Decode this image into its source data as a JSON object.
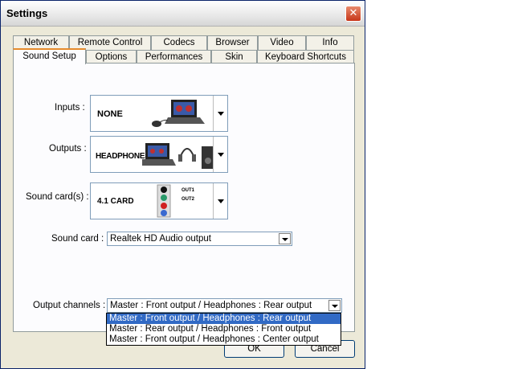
{
  "window": {
    "title": "Settings",
    "close_glyph": "✕"
  },
  "tabs_row1": [
    {
      "label": "Network"
    },
    {
      "label": "Remote Control"
    },
    {
      "label": "Codecs"
    },
    {
      "label": "Browser"
    },
    {
      "label": "Video"
    },
    {
      "label": "Info"
    }
  ],
  "tabs_row2": [
    {
      "label": "Sound Setup",
      "active": true
    },
    {
      "label": "Options"
    },
    {
      "label": "Performances"
    },
    {
      "label": "Skin"
    },
    {
      "label": "Keyboard Shortcuts"
    }
  ],
  "sound": {
    "inputs_label": "Inputs :",
    "inputs_value": "NONE",
    "outputs_label": "Outputs :",
    "outputs_value": "HEADPHONES",
    "cards_label": "Sound card(s) :",
    "cards_value": "4.1 CARD",
    "out1": "OUT1",
    "out2": "OUT2",
    "soundcard_label": "Sound card :",
    "soundcard_value": "Realtek HD Audio output",
    "channels_label": "Output channels :",
    "channels_value": "Master : Front output / Headphones : Rear output",
    "channels_options": [
      "Master : Front output / Headphones : Rear output",
      "Master : Rear output / Headphones : Front output",
      "Master : Front output / Headphones : Center output"
    ]
  },
  "buttons": {
    "ok": "OK",
    "cancel": "Cancel"
  },
  "colors": {
    "accent_tab": "#e68b2c",
    "selection": "#316ac5",
    "close": "#c7361a"
  }
}
